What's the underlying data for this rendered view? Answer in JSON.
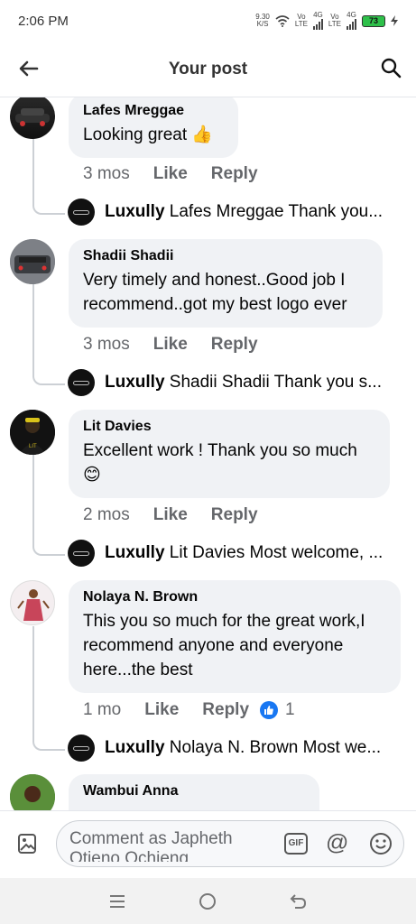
{
  "status": {
    "time": "2:06 PM",
    "net_speed_value": "9.30",
    "net_speed_unit": "K/S",
    "sim1_vo": "Vo",
    "sim1_lte": "LTE",
    "sim1_gen": "4G",
    "sim2_vo": "Vo",
    "sim2_lte": "LTE",
    "sim2_gen": "4G",
    "battery": "73",
    "battery_color": "#2ec04a"
  },
  "header": {
    "title": "Your post",
    "back_icon": "arrow-left-icon",
    "search_icon": "search-icon"
  },
  "comments": [
    {
      "author": "Lafes Mreggae",
      "text": "Looking great 👍",
      "time": "3 mos",
      "like": "Like",
      "reply": "Reply",
      "reply_author": "Luxully",
      "reply_text": "Lafes Mreggae Thank you..."
    },
    {
      "author": "Shadii Shadii",
      "text": "Very timely and honest..Good job I recommend..got my best logo ever",
      "time": "3 mos",
      "like": "Like",
      "reply": "Reply",
      "reply_author": "Luxully",
      "reply_text": "Shadii Shadii Thank you s..."
    },
    {
      "author": "Lit Davies",
      "text": "Excellent work ! Thank you so much 😊",
      "time": "2 mos",
      "like": "Like",
      "reply": "Reply",
      "reply_author": "Luxully",
      "reply_text": "Lit Davies Most welcome, ..."
    },
    {
      "author": "Nolaya N. Brown",
      "text": "This you so much for the great work,I recommend anyone and everyone here...the best",
      "time": "1 mo",
      "like": "Like",
      "reply": "Reply",
      "reaction_count": "1",
      "reply_author": "Luxully",
      "reply_text": "Nolaya N. Brown Most we..."
    },
    {
      "author": "Wambui Anna",
      "text": ""
    }
  ],
  "composer": {
    "placeholder": "Comment as Japheth Otieno Ochieng",
    "gif_label": "GIF",
    "at_label": "@"
  },
  "colors": {
    "accent": "#1877f2",
    "bubble": "#f0f2f5",
    "secondary_text": "#65676b"
  }
}
